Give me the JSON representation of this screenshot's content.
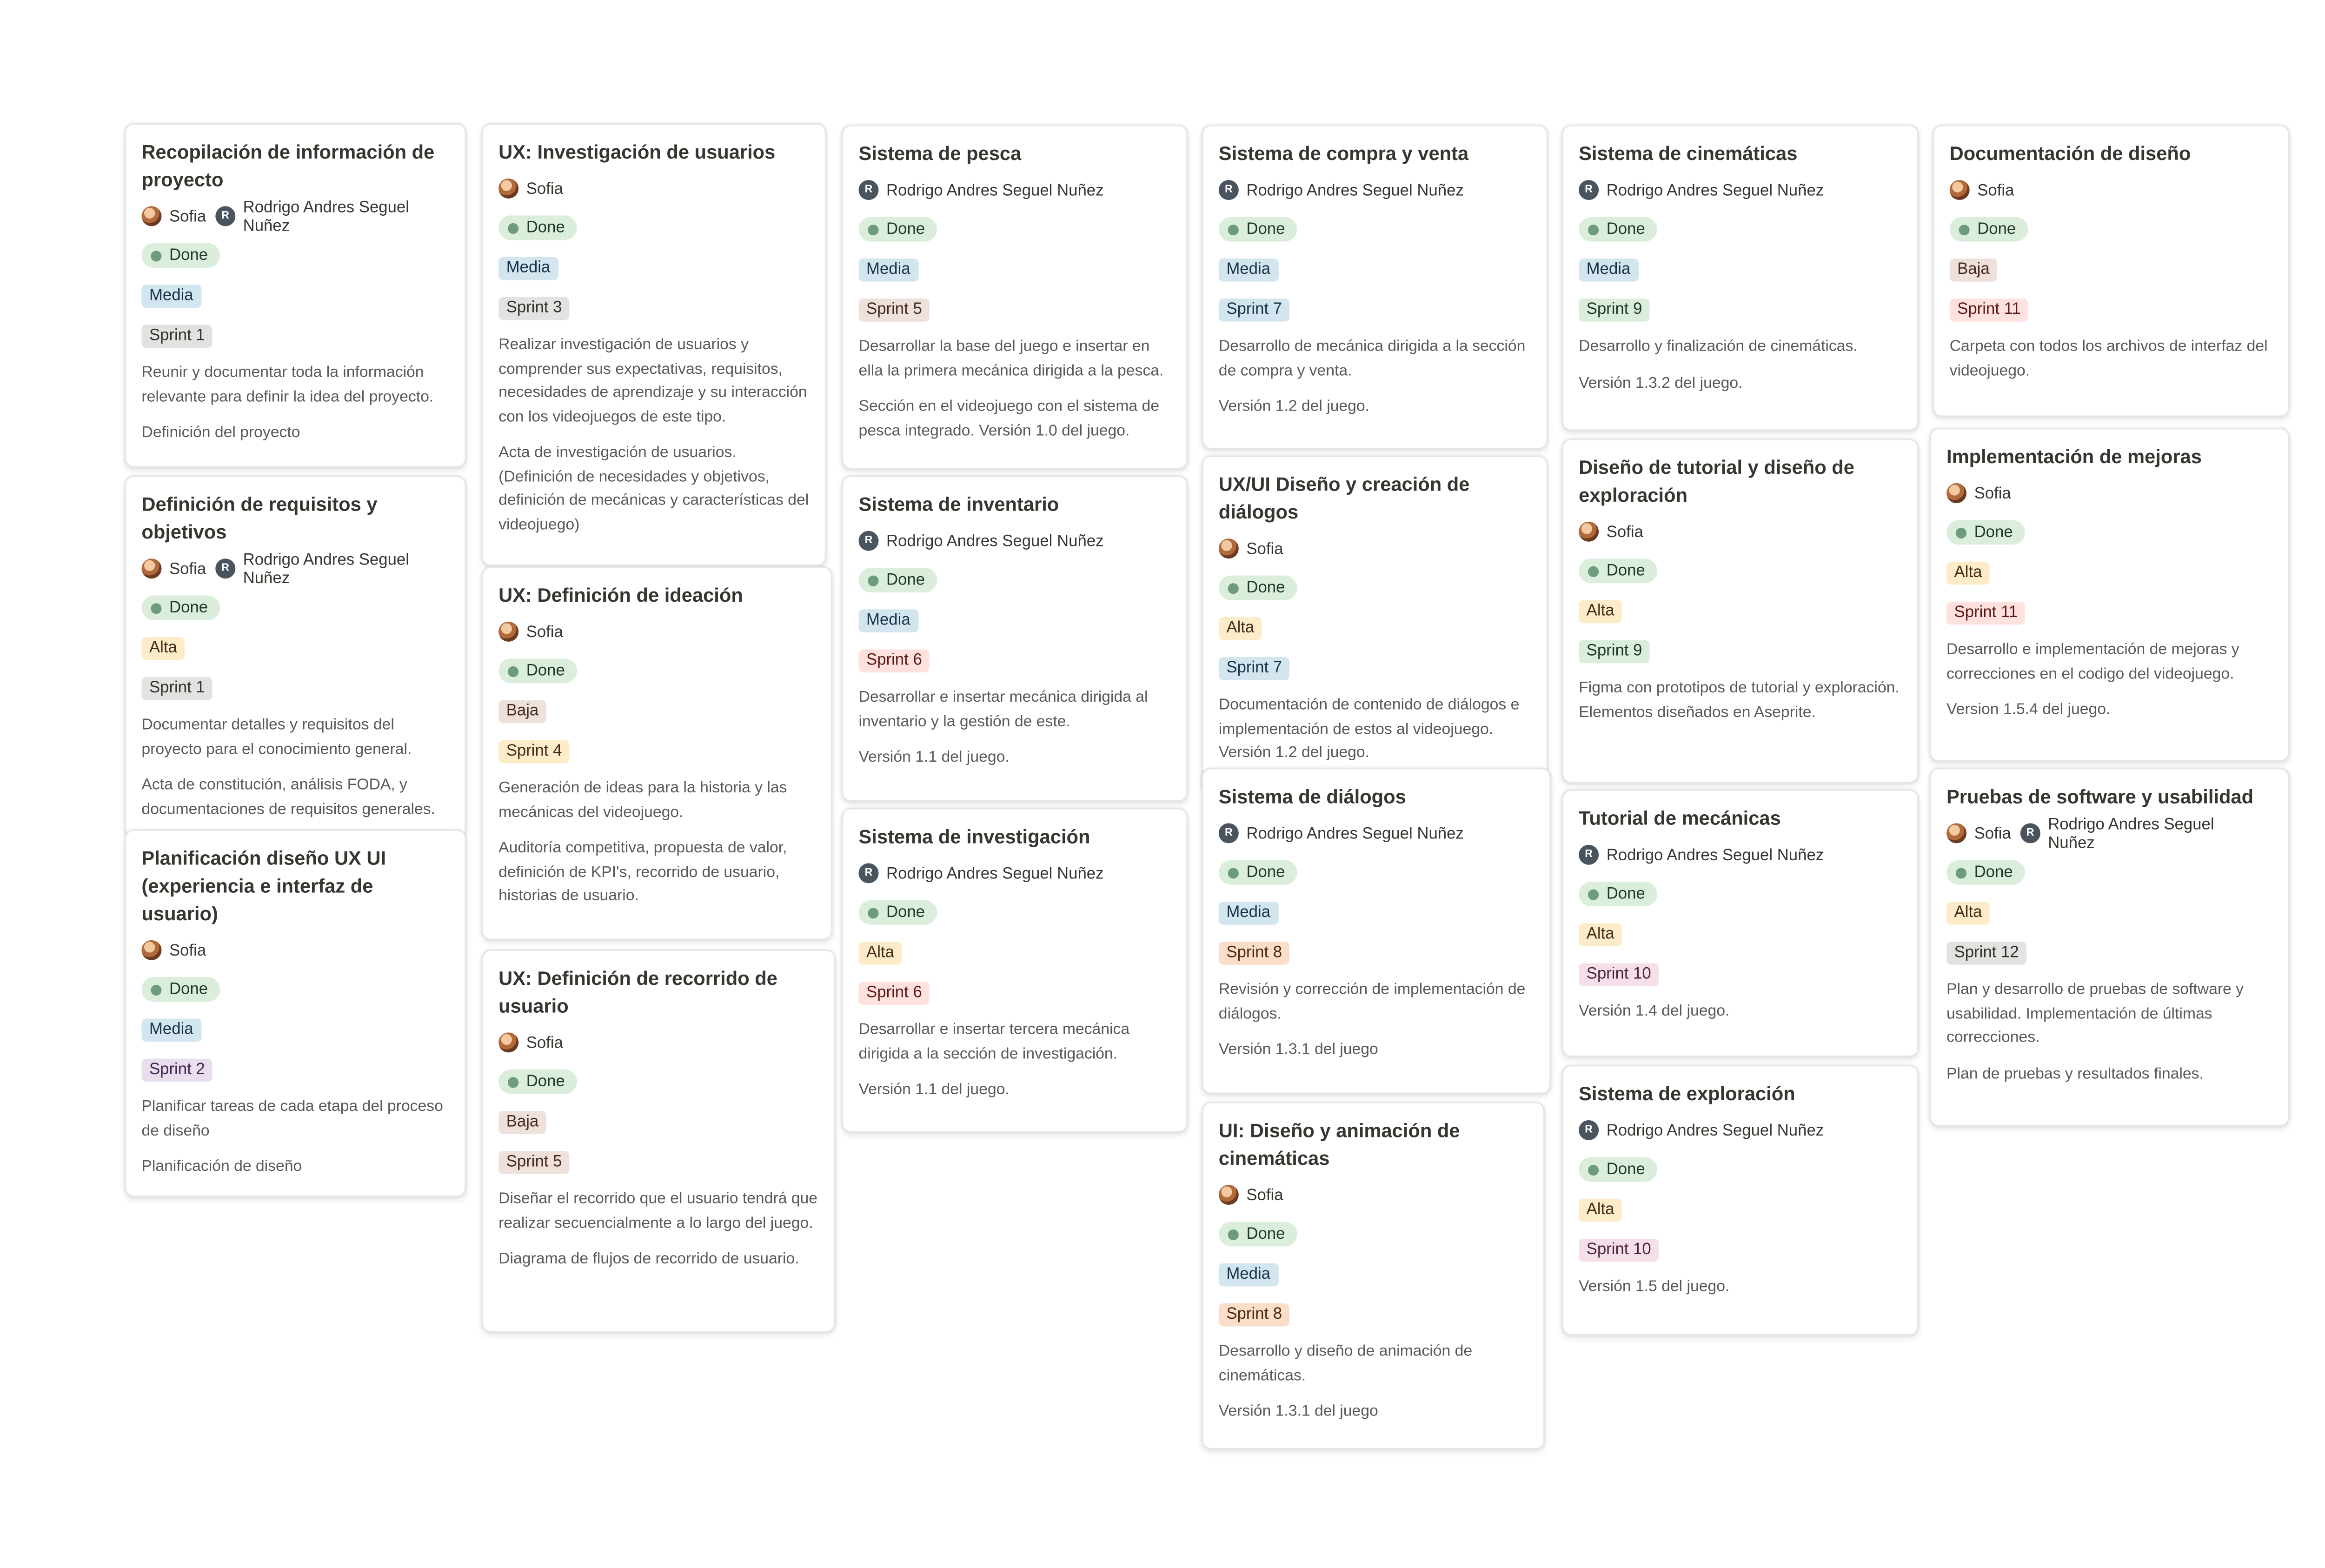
{
  "people": {
    "sofia": "Sofia",
    "rodrigo": "Rodrigo Andres Seguel Nuñez",
    "rodrigo_initial": "R"
  },
  "colors": {
    "status_done_bg": "#dbeddb",
    "status_done_dot": "#6c9b7d",
    "priority": {
      "Media": {
        "bg": "#d3e5ef",
        "fg": "#183347"
      },
      "Alta": {
        "bg": "#fdecc8",
        "fg": "#402c1b"
      },
      "Baja": {
        "bg": "#eee0da",
        "fg": "#442a1e"
      }
    },
    "sprint": {
      "gray": {
        "bg": "#e3e2e0",
        "fg": "#32302c"
      },
      "purple": {
        "bg": "#e8deee",
        "fg": "#412454"
      },
      "brown": {
        "bg": "#eee0da",
        "fg": "#442a1e"
      },
      "yellow": {
        "bg": "#fdecc8",
        "fg": "#402c1b"
      },
      "red": {
        "bg": "#ffe2dd",
        "fg": "#5d1715"
      },
      "blue": {
        "bg": "#d3e5ef",
        "fg": "#183347"
      },
      "orange": {
        "bg": "#fadec9",
        "fg": "#49290e"
      },
      "green": {
        "bg": "#dbeddb",
        "fg": "#1c3829"
      },
      "pink": {
        "bg": "#f5e0e9",
        "fg": "#4c2337"
      }
    }
  },
  "cards": [
    {
      "title": "Recopilación de información de proyecto",
      "assignees": [
        "sofia",
        "rodrigo"
      ],
      "status": "Done",
      "priority": "Media",
      "sprint": "Sprint 1",
      "sprint_color": "gray",
      "description": "Reunir y documentar toda la información relevante para definir la idea del proyecto.",
      "deliverable": "Definición del proyecto"
    },
    {
      "title": "Definición de requisitos y objetivos",
      "assignees": [
        "sofia",
        "rodrigo"
      ],
      "status": "Done",
      "priority": "Alta",
      "sprint": "Sprint 1",
      "sprint_color": "gray",
      "description": "Documentar detalles y requisitos del proyecto para el conocimiento general.",
      "deliverable": "Acta de constitución, análisis FODA, y documentaciones de requisitos generales."
    },
    {
      "title": "Planificación diseño UX UI (experiencia e interfaz de usuario)",
      "assignees": [
        "sofia"
      ],
      "status": "Done",
      "priority": "Media",
      "sprint": "Sprint 2",
      "sprint_color": "purple",
      "description": "Planificar tareas de cada etapa del proceso de diseño",
      "deliverable": "Planificación de diseño"
    },
    {
      "title": "UX: Investigación de usuarios",
      "assignees": [
        "sofia"
      ],
      "status": "Done",
      "priority": "Media",
      "sprint": "Sprint 3",
      "sprint_color": "gray",
      "description": "Realizar investigación de usuarios y comprender sus expectativas, requisitos, necesidades de aprendizaje y su interacción con los videojuegos de este tipo.",
      "deliverable": "Acta de investigación de usuarios. (Definición de necesidades y objetivos, definición de mecánicas y características del videojuego)"
    },
    {
      "title": "UX: Definición de ideación",
      "assignees": [
        "sofia"
      ],
      "status": "Done",
      "priority": "Baja",
      "sprint": "Sprint 4",
      "sprint_color": "yellow",
      "description": "Generación de ideas para la historia y las mecánicas del videojuego.",
      "deliverable": "Auditoría competitiva, propuesta de valor, definición de KPI's, recorrido de usuario, historias de usuario."
    },
    {
      "title": "UX: Definición de recorrido de usuario",
      "assignees": [
        "sofia"
      ],
      "status": "Done",
      "priority": "Baja",
      "sprint": "Sprint 5",
      "sprint_color": "brown",
      "description": "Diseñar el recorrido que el usuario tendrá que realizar secuencialmente a lo largo del juego.",
      "deliverable": "Diagrama de flujos de recorrido de usuario."
    },
    {
      "title": "Sistema de pesca",
      "assignees": [
        "rodrigo"
      ],
      "status": "Done",
      "priority": "Media",
      "sprint": "Sprint 5",
      "sprint_color": "brown",
      "description": "Desarrollar la base del juego e insertar en ella la primera mecánica dirigida a la pesca.",
      "deliverable": "Sección en el videojuego con el sistema de pesca integrado. Versión 1.0 del juego."
    },
    {
      "title": "Sistema de inventario",
      "assignees": [
        "rodrigo"
      ],
      "status": "Done",
      "priority": "Media",
      "sprint": "Sprint 6",
      "sprint_color": "red",
      "description": "Desarrollar e insertar mecánica dirigida al inventario y la gestión de este.",
      "deliverable": "Versión 1.1 del juego."
    },
    {
      "title": "Sistema de investigación",
      "assignees": [
        "rodrigo"
      ],
      "status": "Done",
      "priority": "Alta",
      "sprint": "Sprint 6",
      "sprint_color": "red",
      "description": "Desarrollar e insertar tercera mecánica dirigida a la sección de investigación.",
      "deliverable": "Versión 1.1 del juego."
    },
    {
      "title": "Sistema de compra y venta",
      "assignees": [
        "rodrigo"
      ],
      "status": "Done",
      "priority": "Media",
      "sprint": "Sprint 7",
      "sprint_color": "blue",
      "description": "Desarrollo de mecánica dirigida a la sección de compra y venta.",
      "deliverable": "Versión 1.2 del juego."
    },
    {
      "title": "UX/UI Diseño y creación de diálogos",
      "assignees": [
        "sofia"
      ],
      "status": "Done",
      "priority": "Alta",
      "sprint": "Sprint 7",
      "sprint_color": "blue",
      "description": "Documentación de contenido de diálogos e implementación de estos al videojuego. Versión 1.2 del juego.",
      "deliverable": ""
    },
    {
      "title": "Sistema de diálogos",
      "assignees": [
        "rodrigo"
      ],
      "status": "Done",
      "priority": "Media",
      "sprint": "Sprint 8",
      "sprint_color": "orange",
      "description": "Revisión y corrección de implementación de diálogos.",
      "deliverable": "Versión 1.3.1 del juego"
    },
    {
      "title": "UI: Diseño y animación de cinemáticas",
      "assignees": [
        "sofia"
      ],
      "status": "Done",
      "priority": "Media",
      "sprint": "Sprint 8",
      "sprint_color": "orange",
      "description": "Desarrollo y diseño de animación de cinemáticas.",
      "deliverable": "Versión 1.3.1 del juego"
    },
    {
      "title": "Sistema de cinemáticas",
      "assignees": [
        "rodrigo"
      ],
      "status": "Done",
      "priority": "Media",
      "sprint": "Sprint 9",
      "sprint_color": "green",
      "description": "Desarrollo y finalización de cinemáticas.",
      "deliverable": "Versión 1.3.2 del juego."
    },
    {
      "title": "Diseño de tutorial y diseño de exploración",
      "assignees": [
        "sofia"
      ],
      "status": "Done",
      "priority": "Alta",
      "sprint": "Sprint 9",
      "sprint_color": "green",
      "description": "Figma con prototipos de tutorial y exploración. Elementos diseñados en Aseprite.",
      "deliverable": ""
    },
    {
      "title": "Tutorial de mecánicas",
      "assignees": [
        "rodrigo"
      ],
      "status": "Done",
      "priority": "Alta",
      "sprint": "Sprint 10",
      "sprint_color": "pink",
      "description": "",
      "deliverable": "Versión 1.4 del juego."
    },
    {
      "title": "Sistema de exploración",
      "assignees": [
        "rodrigo"
      ],
      "status": "Done",
      "priority": "Alta",
      "sprint": "Sprint 10",
      "sprint_color": "pink",
      "description": "",
      "deliverable": "Versión 1.5 del juego."
    },
    {
      "title": "Documentación de diseño",
      "assignees": [
        "sofia"
      ],
      "status": "Done",
      "priority": "Baja",
      "sprint": "Sprint 11",
      "sprint_color": "red",
      "description": "Carpeta con todos los archivos de interfaz del videojuego.",
      "deliverable": ""
    },
    {
      "title": "Implementación de mejoras",
      "assignees": [
        "sofia"
      ],
      "status": "Done",
      "priority": "Alta",
      "sprint": "Sprint 11",
      "sprint_color": "red",
      "description": "Desarrollo e implementación de mejoras y correcciones en el codigo del videojuego.",
      "deliverable": "Version 1.5.4 del juego."
    },
    {
      "title": "Pruebas de software y usabilidad",
      "assignees": [
        "sofia",
        "rodrigo"
      ],
      "status": "Done",
      "priority": "Alta",
      "sprint": "Sprint 12",
      "sprint_color": "gray",
      "description": "Plan y desarrollo de pruebas de software y usabilidad. Implementación de últimas correcciones.",
      "deliverable": "Plan de pruebas y resultados finales."
    }
  ]
}
